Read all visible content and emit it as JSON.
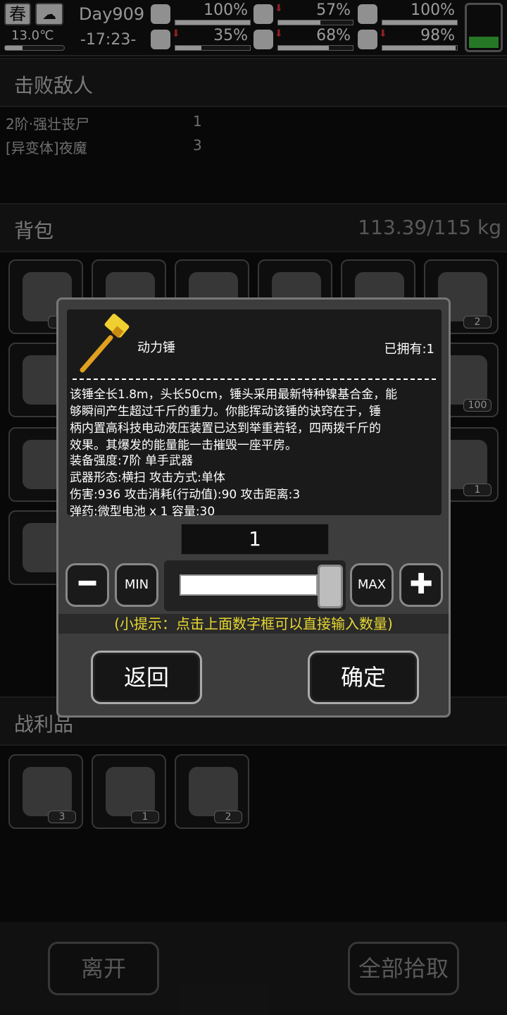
{
  "status_bar": {
    "season": "春",
    "weather_icon": "cloud-rain-icon",
    "temperature": "13.0℃",
    "day": "Day909",
    "time": "-17:23-",
    "stats": [
      {
        "name": "health",
        "icon": "medkit-icon",
        "value": "100%",
        "fill": 1.0,
        "alert": false
      },
      {
        "name": "hunger",
        "icon": "stomach-icon",
        "value": "57%",
        "fill": 0.57,
        "alert": true
      },
      {
        "name": "energy",
        "icon": "battery-icon",
        "value": "100%",
        "fill": 1.0,
        "alert": false
      },
      {
        "name": "stamina",
        "icon": "boot-icon",
        "value": "35%",
        "fill": 0.35,
        "alert": true
      },
      {
        "name": "thirst",
        "icon": "water-drop-icon",
        "value": "68%",
        "fill": 0.68,
        "alert": true
      },
      {
        "name": "mood",
        "icon": "heart-icon",
        "value": "98%",
        "fill": 0.98,
        "alert": true
      }
    ],
    "battery_color": "#3bb93b"
  },
  "defeated": {
    "title": "击败敌人",
    "rows": [
      {
        "name": "2阶·强壮丧尸",
        "count": "1"
      },
      {
        "name": "[异变体]夜魔",
        "count": "3"
      }
    ]
  },
  "backpack": {
    "title": "背包",
    "weight": "113.39/115 kg",
    "badges": [
      "1",
      "2",
      "100",
      "1"
    ]
  },
  "loot": {
    "title": "战利品",
    "badges": [
      "3",
      "1",
      "2"
    ]
  },
  "dialog": {
    "item_name": "动力锤",
    "owned": "已拥有:1",
    "description_lines": [
      "该锤全长1.8m，头长50cm，锤头采用最新特种镍基合金，能",
      "够瞬间产生超过千斤的重力。你能挥动该锤的诀窍在于，锤",
      "柄内置高科技电动液压装置已达到举重若轻，四两拨千斤的",
      "效果。其爆发的能量能一击摧毁一座平房。"
    ],
    "stat_lines": [
      "装备强度:7阶 单手武器",
      "武器形态:横扫 攻击方式:单体",
      " 伤害:936 攻击消耗(行动值):90 攻击距离:3",
      "弹药:微型电池 x 1 容量:30"
    ],
    "quantity": "1",
    "min_label": "MIN",
    "max_label": "MAX",
    "tip": "(小提示：点击上面数字框可以直接输入数量)",
    "back_label": "返回",
    "confirm_label": "确定",
    "accent_color": "#e8d830"
  },
  "bottom": {
    "leave_label": "离开",
    "pickup_all_label": "全部拾取"
  }
}
